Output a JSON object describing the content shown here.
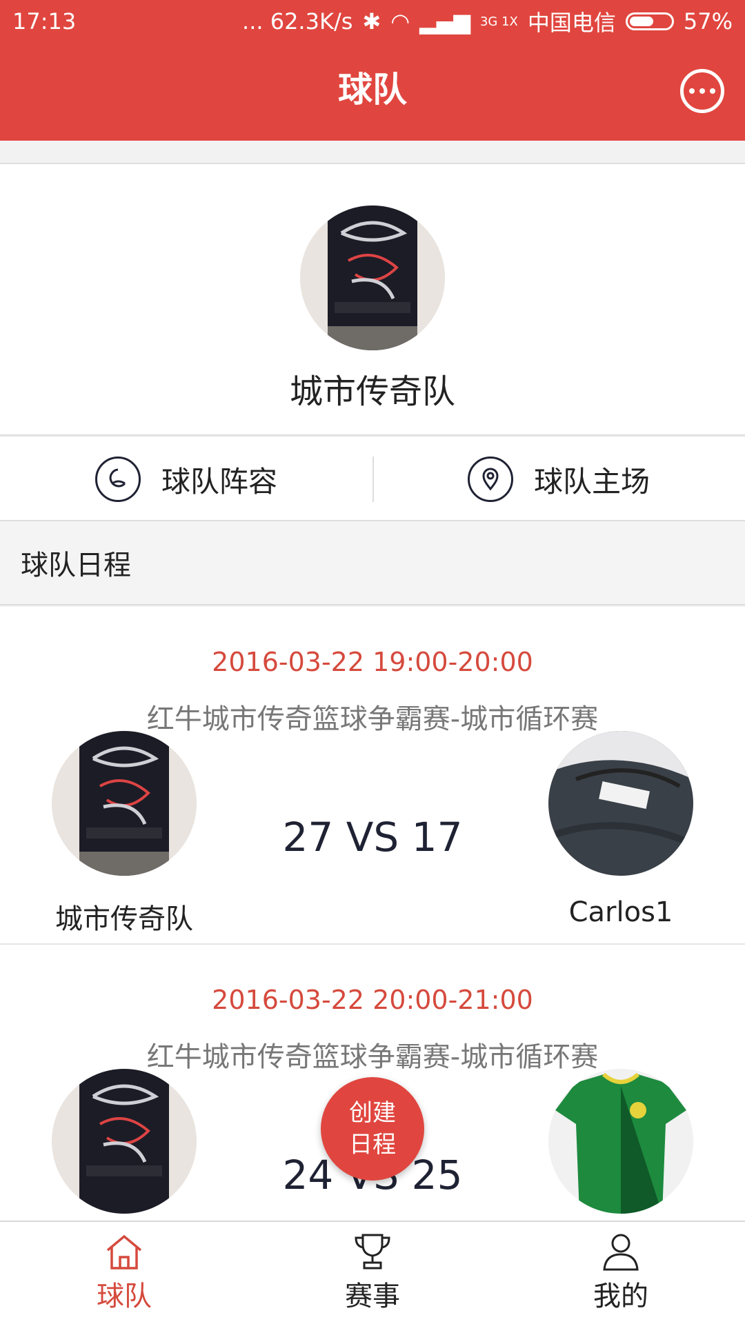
{
  "status_bar": {
    "time": "17:13",
    "network_speed": "... 62.3K/s",
    "network_type": "3G 1X",
    "carrier": "中国电信",
    "battery": "57%"
  },
  "header": {
    "title": "球队",
    "bg_color": "#e0463f"
  },
  "team": {
    "name": "城市传奇队"
  },
  "actions": [
    {
      "label": "球队阵容",
      "icon": "roster-icon"
    },
    {
      "label": "球队主场",
      "icon": "location-pin-icon"
    }
  ],
  "schedule": {
    "title": "球队日程",
    "matches": [
      {
        "time": "2016-03-22 19:00-20:00",
        "event": "红牛城市传奇篮球争霸赛-城市循环赛",
        "score": "27 VS 17",
        "home": "城市传奇队",
        "away": "Carlos1"
      },
      {
        "time": "2016-03-22 20:00-21:00",
        "event": "红牛城市传奇篮球争霸赛-城市循环赛",
        "score": "24 VS 25",
        "home": "",
        "away": ""
      }
    ]
  },
  "fab": {
    "line1": "创建",
    "line2": "日程"
  },
  "tabs": [
    {
      "label": "球队",
      "icon": "home-icon",
      "active": true
    },
    {
      "label": "赛事",
      "icon": "trophy-icon",
      "active": false
    },
    {
      "label": "我的",
      "icon": "user-icon",
      "active": false
    }
  ],
  "colors": {
    "accent": "#e0463f",
    "date_red": "#d54a3d"
  }
}
